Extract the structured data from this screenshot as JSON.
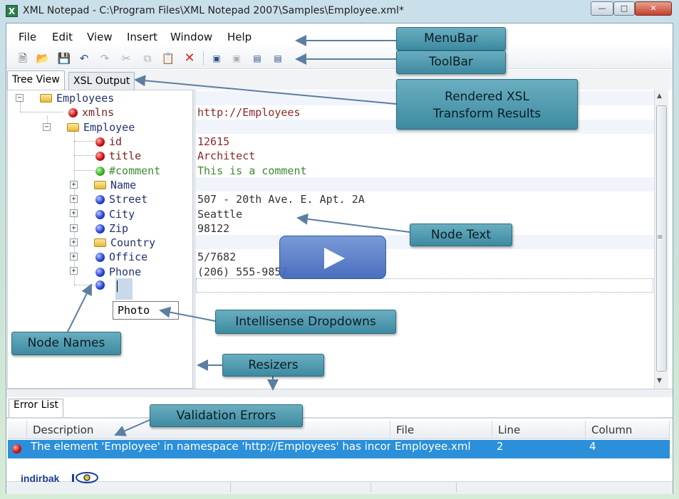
{
  "window": {
    "title": "XML Notepad - C:\\Program Files\\XML Notepad 2007\\Samples\\Employee.xml*",
    "icon_letter": "X"
  },
  "menubar": [
    "File",
    "Edit",
    "View",
    "Insert",
    "Window",
    "Help"
  ],
  "toolbar_icons": [
    "new-file-icon",
    "open-folder-icon",
    "save-icon",
    "undo-icon",
    "redo-icon",
    "cut-icon",
    "copy-icon",
    "paste-icon",
    "delete-icon",
    "nudge-up-icon",
    "nudge-down-icon",
    "nudge-left-icon",
    "nudge-right-icon"
  ],
  "tabs": {
    "tree_view": "Tree View",
    "xsl_output": "XSL Output"
  },
  "tree": {
    "root": "Employees",
    "xmlns": "xmlns",
    "employee": "Employee",
    "id": "id",
    "title": "title",
    "comment": "#comment",
    "name": "Name",
    "street": "Street",
    "city": "City",
    "zip": "Zip",
    "country": "Country",
    "office": "Office",
    "phone": "Phone"
  },
  "values": {
    "xmlns": "http://Employees",
    "id": "12615",
    "title": "Architect",
    "comment": "This is a comment",
    "street": "507 - 20th Ave. E. Apt. 2A",
    "city": "Seattle",
    "zip": "98122",
    "office": "5/7682",
    "phone": "(206) 555-9857"
  },
  "intellisense": {
    "option": "Photo"
  },
  "callouts": {
    "menubar": "MenuBar",
    "toolbar": "ToolBar",
    "xsl_line1": "Rendered XSL",
    "xsl_line2": "Transform Results",
    "node_text": "Node Text",
    "intellisense": "Intellisense Dropdowns",
    "node_names": "Node Names",
    "resizers": "Resizers",
    "validation": "Validation Errors"
  },
  "error_list": {
    "tab": "Error List",
    "columns": {
      "description": "Description",
      "file": "File",
      "line": "Line",
      "column": "Column"
    },
    "rows": [
      {
        "description": "The element 'Employee' in namespace 'http://Employees' has incompl...",
        "file": "Employee.xml",
        "line": "2",
        "column": "4"
      }
    ]
  },
  "watermark": {
    "text": "indirbak"
  }
}
